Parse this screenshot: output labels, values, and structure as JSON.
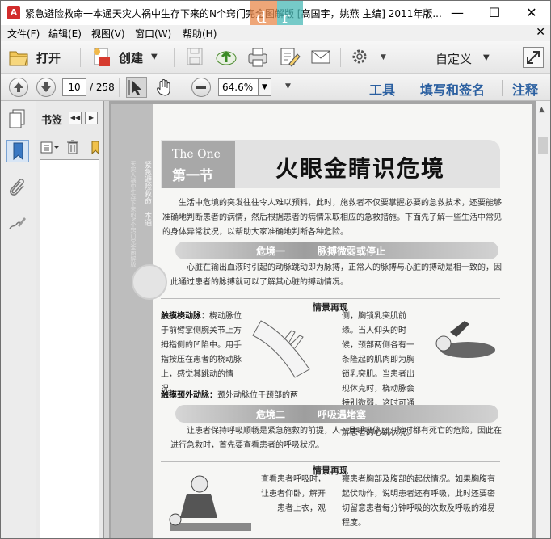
{
  "window": {
    "title": "紧急避险救命一本通天灾人祸中生存下来的N个窍门完全图解版 [高国宇，姚燕 主编] 2011年版...",
    "minimize": "—",
    "maximize": "☐",
    "close": "✕"
  },
  "menu": {
    "items": [
      "文件(F)",
      "编辑(E)",
      "视图(V)",
      "窗口(W)",
      "帮助(H)"
    ],
    "close": "✕"
  },
  "toolbar": {
    "open_label": "打开",
    "create_label": "创建",
    "custom_label": "自定义"
  },
  "nav": {
    "page_current": "10",
    "page_total": "/ 258",
    "zoom": "64.6%",
    "tabs": [
      "工具",
      "填写和签名",
      "注释"
    ]
  },
  "bookmarks": {
    "title": "书签"
  },
  "page": {
    "side_title": "紧急避险救命一本通",
    "side_subtitle": "天灾人祸中生存下来的N个窍门完全图解版",
    "section_en": "The One",
    "section_cn": "第一节",
    "title": "火眼金睛识危境",
    "intro": "生活中危境的突发往往令人难以预料，此时，施救者不仅要掌握必要的急救技术，还要能够准确地判断患者的病情，然后根据患者的病情采取相应的急救措施。下面先了解一些生活中常见的身体异常状况，以帮助大家准确地判断各种危险。",
    "danger1_a": "危境一",
    "danger1_b": "脉搏微弱或停止",
    "danger1_text": "心脏在输出血液时引起的动脉跳动即为脉搏，正常人的脉搏与心脏的搏动是相一致的，因此通过患者的脉搏就可以了解其心脏的搏动情况。",
    "scene1": "情景再现",
    "col1_bold": "触摸桡动脉：",
    "col1_text": "桡动脉位于前臂掌侧腕关节上方拇指侧的凹陷中。用手指按压在患者的桡动脉上，感觉其跳动的情况。",
    "col1_bold2": "触摸颈外动脉：",
    "col1_text2": "颈外动脉位于颈部的两",
    "col2_text": "侧，胸锁乳突肌前缘。当人仰头的时候，颈部两侧各有一条隆起的肌肉即为胸锁乳突肌。当患者出现休克时，桡动脉会特别微弱，这时可通过触诊颈外动脉来了解患者的心跳状况。",
    "danger2_a": "危境二",
    "danger2_b": "呼吸遇堵塞",
    "danger2_text": "让患者保持呼吸顺畅是紧急施救的前提，人一旦呼吸停止，随时都有死亡的危险，因此在进行急救时，首先要查看患者的呼吸状况。",
    "scene2": "情景再现",
    "col3_text": "查看患者呼吸时，让患者仰卧，解开患者上衣，观",
    "col4_text": "察患者胸部及腹部的起伏情况。如果胸腹有起伏动作，说明患者还有呼吸，此时还要密切留意患者每分钟呼吸的次数及呼吸的难易程度。"
  },
  "colors": {
    "accent_blue": "#2a5fa0",
    "doc_bg": "#a5a5a5"
  }
}
